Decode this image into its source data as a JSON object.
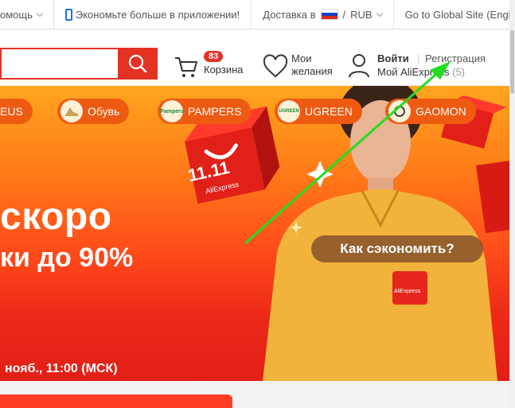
{
  "topbar": {
    "item1": "омощь",
    "app_promo": "Экономьте больше в приложении!",
    "delivery": "Доставка в",
    "currency_sep": "/",
    "currency": "RUB",
    "global_site": "Go to Global Site (English)"
  },
  "search": {
    "placeholder": "",
    "button_icon": "search-icon"
  },
  "cart": {
    "count": "83",
    "label": "Корзина"
  },
  "wishlist": {
    "line1": "Мои",
    "line2": "желания"
  },
  "account": {
    "login": "Войти",
    "separator": "|",
    "register": "Регистрация",
    "my": "Мой AliExpress",
    "count": "(5)"
  },
  "banner": {
    "chips": [
      "EUS",
      "Обувь",
      "PAMPERS",
      "UGREEN",
      "GAOMON"
    ],
    "chip_icon_pampers": "Pampers",
    "chip_icon_ugreen": "UGREEN",
    "headline": "скоро",
    "subline": "ки до 90%",
    "cta": "Как сэкономить?",
    "date": "нояб., 11:00 (МСК)",
    "box_text": "11.11",
    "box_brand": "AliExpress",
    "pocket_brand": "AliExpress"
  },
  "colors": {
    "accent": "#e43225",
    "annotation_arrow": "#22dd22"
  }
}
